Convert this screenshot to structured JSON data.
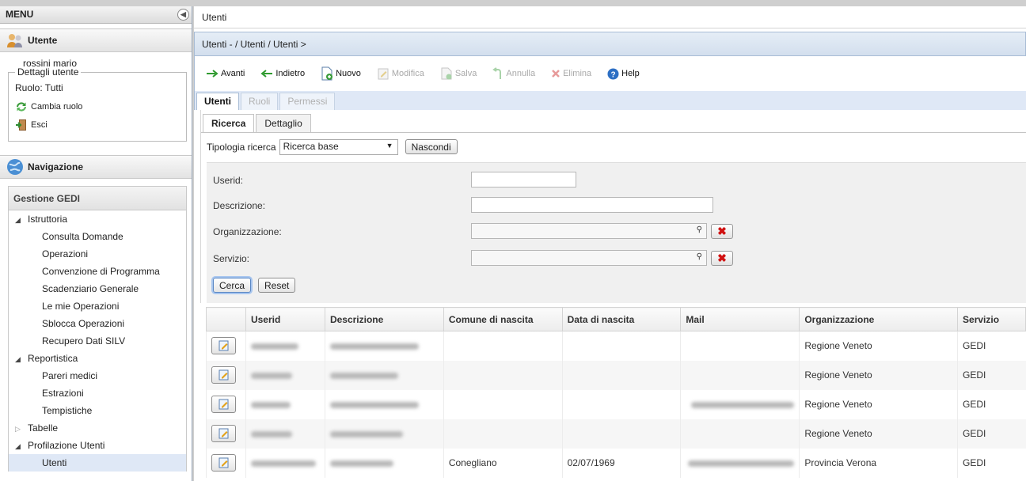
{
  "sidebar": {
    "menu_title": "MENU",
    "user_panel": {
      "title": "Utente",
      "user_name": "rossini mario"
    },
    "details": {
      "legend": "Dettagli utente",
      "role": "Ruolo: Tutti",
      "change_role": "Cambia ruolo",
      "logout": "Esci"
    },
    "nav_panel": {
      "title": "Navigazione"
    },
    "group": "Gestione GEDI",
    "tree": [
      {
        "label": "Istruttoria",
        "expanded": true,
        "children": [
          "Consulta Domande",
          "Operazioni",
          "Convenzione di Programma",
          "Scadenziario Generale",
          "Le mie Operazioni",
          "Sblocca Operazioni",
          "Recupero Dati SILV"
        ]
      },
      {
        "label": "Reportistica",
        "expanded": true,
        "children": [
          "Pareri medici",
          "Estrazioni",
          "Tempistiche"
        ]
      },
      {
        "label": "Tabelle",
        "expanded": false,
        "children": []
      },
      {
        "label": "Profilazione Utenti",
        "expanded": true,
        "children": [
          "Utenti"
        ]
      }
    ]
  },
  "main": {
    "title": "Utenti",
    "breadcrumb": "Utenti - / Utenti / Utenti >",
    "toolbar": {
      "avanti": "Avanti",
      "indietro": "Indietro",
      "nuovo": "Nuovo",
      "modifica": "Modifica",
      "salva": "Salva",
      "annulla": "Annulla",
      "elimina": "Elimina",
      "help": "Help"
    },
    "tabs": [
      "Utenti",
      "Ruoli",
      "Permessi"
    ],
    "subtabs": [
      "Ricerca",
      "Dettaglio"
    ],
    "search": {
      "type_label": "Tipologia ricerca",
      "type_value": "Ricerca base",
      "hide_button": "Nascondi"
    },
    "filters": {
      "userid": "Userid:",
      "descrizione": "Descrizione:",
      "organizzazione": "Organizzazione:",
      "servizio": "Servizio:",
      "search_button": "Cerca",
      "reset_button": "Reset"
    },
    "columns": [
      "Userid",
      "Descrizione",
      "Comune di nascita",
      "Data di nascita",
      "Mail",
      "Organizzazione",
      "Servizio"
    ],
    "rows": [
      {
        "comune": "",
        "data": "",
        "organizzazione": "Regione Veneto",
        "servizio": "GEDI"
      },
      {
        "comune": "",
        "data": "",
        "organizzazione": "Regione Veneto",
        "servizio": "GEDI"
      },
      {
        "comune": "",
        "data": "",
        "organizzazione": "Regione Veneto",
        "servizio": "GEDI"
      },
      {
        "comune": "",
        "data": "",
        "organizzazione": "Regione Veneto",
        "servizio": "GEDI"
      },
      {
        "comune": "Conegliano",
        "data": "02/07/1969",
        "organizzazione": "Provincia Verona",
        "servizio": "GEDI"
      }
    ]
  }
}
